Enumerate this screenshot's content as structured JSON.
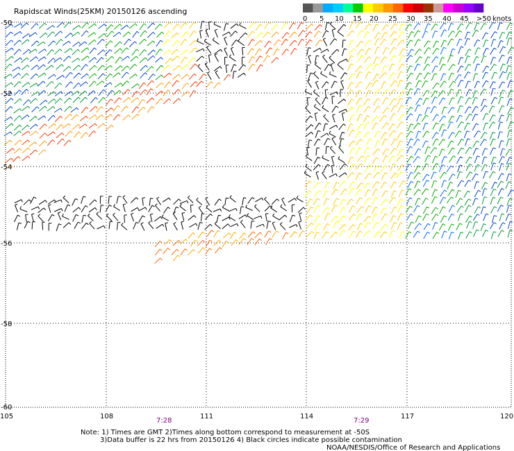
{
  "title": "Rapidscat Winds(25KM) 20150126 ascending",
  "legend": {
    "unit": "knots",
    "colors": [
      "#555555",
      "#999999",
      "#00aaff",
      "#00ccff",
      "#00ff99",
      "#00cc00",
      "#ffff00",
      "#ffcc00",
      "#ff9900",
      "#ff6600",
      "#ff0000",
      "#cc0000",
      "#993300",
      "#cc9999",
      "#ff00ff",
      "#cc00cc",
      "#9900ff",
      "#6600cc"
    ],
    "labels": [
      "0",
      "5",
      "10",
      "15",
      "20",
      "25",
      "30",
      "35",
      "40",
      "45",
      ">50"
    ]
  },
  "lat_labels": [
    "-50",
    "-52",
    "-54",
    "-56",
    "-58",
    "-60"
  ],
  "lon_labels": [
    "105",
    "108",
    "111",
    "114",
    "117",
    "120"
  ],
  "times": [
    "7:28",
    "7:29"
  ],
  "notes": [
    "Note: 1) Times are GMT 2)Times along bottom correspond to measurement at -50S",
    "3)Data buffer is 22 hrs from 20150126 4) Black circles indicate possible contamination"
  ],
  "credit": "NOAA/NESDIS/Office of Research and Applications"
}
